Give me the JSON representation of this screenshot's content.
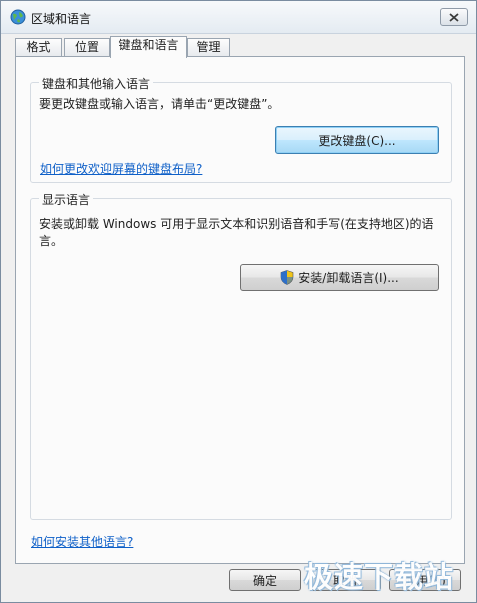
{
  "window": {
    "title": "区域和语言",
    "close_icon": "close-icon",
    "app_icon": "globe-icon"
  },
  "tabs": [
    {
      "label": "格式",
      "active": false
    },
    {
      "label": "位置",
      "active": false
    },
    {
      "label": "键盘和语言",
      "active": true
    },
    {
      "label": "管理",
      "active": false
    }
  ],
  "keyboard_group": {
    "label": "键盘和其他输入语言",
    "description": "要更改键盘或输入语言，请单击“更改键盘”。",
    "button": "更改键盘(C)...",
    "link": "如何更改欢迎屏幕的键盘布局?"
  },
  "display_group": {
    "label": "显示语言",
    "description_line1": "安装或卸载 Windows 可用于显示文本和识别语音和手写(在支持地区)的语",
    "description_line2": "言。",
    "button": "安装/卸载语言(I)..."
  },
  "footer": {
    "link": "如何安装其他语言?",
    "ok": "确定",
    "cancel": "取消",
    "apply": "应用(A)"
  },
  "watermark": "极速下载站",
  "colors": {
    "link": "#0f60c8",
    "focused_button": "#3c7fb1"
  }
}
